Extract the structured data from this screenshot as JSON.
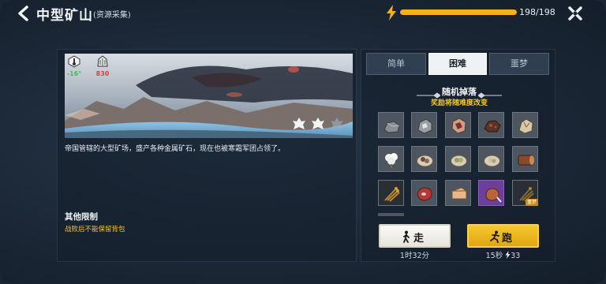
{
  "header": {
    "title": "中型矿山",
    "subtitle": "(资源采集)",
    "energy_value": "198/198",
    "energy_fraction": 1.0,
    "accent_color": "#f1b21c"
  },
  "location": {
    "stats": [
      {
        "icon": "thermometer-icon",
        "value": "-16°",
        "color": "#3ec24a"
      },
      {
        "icon": "frost-shell-icon",
        "value": "830",
        "color": "#e0403a"
      }
    ],
    "description": "帝国管辖的大型矿场，盛产各种金属矿石，现在也被寒霜军团占领了。",
    "limits_title": "其他限制",
    "limits_text": "战败后不能保留背包"
  },
  "difficulty_tabs": [
    {
      "label": "简单",
      "active": false
    },
    {
      "label": "困难",
      "active": true
    },
    {
      "label": "噩梦",
      "active": false
    }
  ],
  "drops": {
    "title": "随机掉落",
    "subtitle": "奖励将随难度改变",
    "items": [
      {
        "icon": "iron-ore-icon"
      },
      {
        "icon": "metal-ore-icon"
      },
      {
        "icon": "raw-meat-icon"
      },
      {
        "icon": "copper-ore-icon"
      },
      {
        "icon": "crystal-ore-icon"
      },
      {
        "icon": "cotton-icon"
      },
      {
        "icon": "ore-bag-icon"
      },
      {
        "icon": "herb-bag-icon"
      },
      {
        "icon": "seed-bag-icon"
      },
      {
        "icon": "wood-log-icon"
      },
      {
        "icon": "wheat-bundle-icon"
      },
      {
        "icon": "steak-icon"
      },
      {
        "icon": "cheese-icon"
      },
      {
        "icon": "roast-meat-icon"
      },
      {
        "icon": "dark-wheat-icon",
        "badge": "噩梦"
      }
    ]
  },
  "actions": {
    "walk_label": "走",
    "walk_time": "1时32分",
    "run_label": "跑",
    "run_time": "15秒",
    "run_cost": "33"
  }
}
